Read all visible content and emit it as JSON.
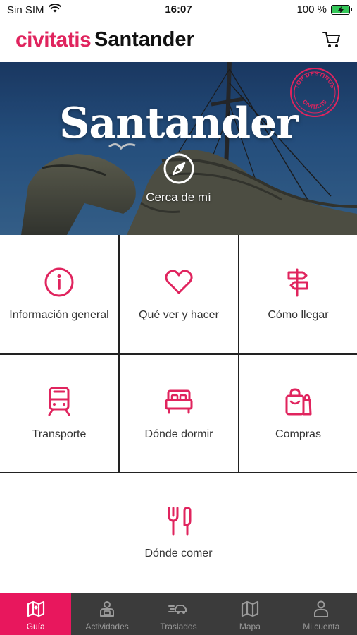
{
  "status_bar": {
    "carrier": "Sin SIM",
    "time": "16:07",
    "battery_text": "100 %",
    "battery_level": 1.0
  },
  "header": {
    "brand": "civitatis",
    "city": "Santander",
    "brand_color": "#e0245e"
  },
  "hero": {
    "title": "Santander",
    "near_me_label": "Cerca de mí",
    "badge": {
      "line1": "TOP DESTINOS",
      "line2": "CIVITATIS"
    }
  },
  "grid": {
    "accent_color": "#e0245e",
    "tiles": [
      {
        "label": "Información general",
        "icon": "info-icon"
      },
      {
        "label": "Qué ver y hacer",
        "icon": "heart-icon"
      },
      {
        "label": "Cómo llegar",
        "icon": "signpost-icon"
      },
      {
        "label": "Transporte",
        "icon": "train-icon"
      },
      {
        "label": "Dónde dormir",
        "icon": "bed-icon"
      },
      {
        "label": "Compras",
        "icon": "shopping-bags-icon"
      },
      {
        "label": "Dónde comer",
        "icon": "fork-knife-icon"
      }
    ]
  },
  "tab_bar": {
    "active_color": "#e8175d",
    "tabs": [
      {
        "label": "Guía",
        "icon": "map-guide-icon",
        "active": true
      },
      {
        "label": "Actividades",
        "icon": "activities-icon",
        "active": false
      },
      {
        "label": "Traslados",
        "icon": "transfer-car-icon",
        "active": false
      },
      {
        "label": "Mapa",
        "icon": "map-icon",
        "active": false
      },
      {
        "label": "Mi cuenta",
        "icon": "user-icon",
        "active": false
      }
    ]
  }
}
